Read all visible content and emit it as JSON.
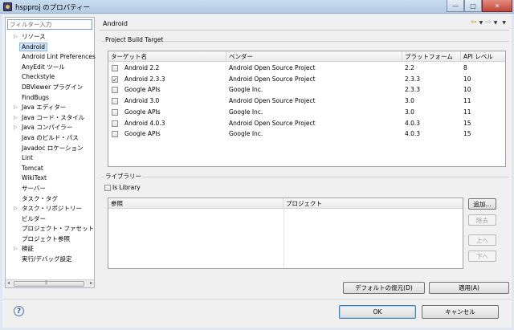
{
  "window": {
    "title": "hspproj のプロパティー",
    "controls": {
      "minimize": "—",
      "maximize": "□",
      "close": "✕"
    }
  },
  "sidebar": {
    "filter_placeholder": "フィルター入力",
    "items": [
      {
        "label": "リソース",
        "expandable": true
      },
      {
        "label": "Android",
        "selected": true
      },
      {
        "label": "Android Lint Preferences"
      },
      {
        "label": "AnyEdit ツール"
      },
      {
        "label": "Checkstyle"
      },
      {
        "label": "DBViewer プラグイン"
      },
      {
        "label": "FindBugs"
      },
      {
        "label": "Java エディター",
        "expandable": true
      },
      {
        "label": "Java コード・スタイル",
        "expandable": true
      },
      {
        "label": "Java コンパイラー",
        "expandable": true
      },
      {
        "label": "Java のビルド・パス"
      },
      {
        "label": "Javadoc ロケーション"
      },
      {
        "label": "Lint"
      },
      {
        "label": "Tomcat"
      },
      {
        "label": "WikiText"
      },
      {
        "label": "サーバー"
      },
      {
        "label": "タスク・タグ"
      },
      {
        "label": "タスク・リポジトリー",
        "expandable": true
      },
      {
        "label": "ビルダー"
      },
      {
        "label": "プロジェクト・ファセット"
      },
      {
        "label": "プロジェクト参照"
      },
      {
        "label": "検証",
        "expandable": true
      },
      {
        "label": "実行/デバッグ設定"
      }
    ]
  },
  "page": {
    "title": "Android"
  },
  "build_target": {
    "group_label": "Project Build Target",
    "columns": [
      "ターゲット名",
      "ベンダー",
      "プラットフォーム",
      "API レベル"
    ],
    "rows": [
      {
        "name": "Android 2.2",
        "vendor": "Android Open Source Project",
        "platform": "2.2",
        "api": "8",
        "checked": false
      },
      {
        "name": "Android 2.3.3",
        "vendor": "Android Open Source Project",
        "platform": "2.3.3",
        "api": "10",
        "checked": true
      },
      {
        "name": "Google APIs",
        "vendor": "Google Inc.",
        "platform": "2.3.3",
        "api": "10",
        "checked": false
      },
      {
        "name": "Android 3.0",
        "vendor": "Android Open Source Project",
        "platform": "3.0",
        "api": "11",
        "checked": false
      },
      {
        "name": "Google APIs",
        "vendor": "Google Inc.",
        "platform": "3.0",
        "api": "11",
        "checked": false
      },
      {
        "name": "Android 4.0.3",
        "vendor": "Android Open Source Project",
        "platform": "4.0.3",
        "api": "15",
        "checked": false
      },
      {
        "name": "Google APIs",
        "vendor": "Google Inc.",
        "platform": "4.0.3",
        "api": "15",
        "checked": false
      }
    ]
  },
  "library": {
    "group_label": "ライブラリー",
    "is_library_label": "Is Library",
    "is_library_checked": false,
    "columns": [
      "参照",
      "プロジェクト"
    ],
    "buttons": {
      "add": "追加...",
      "remove": "除去",
      "up": "上へ",
      "down": "下へ"
    }
  },
  "buttons": {
    "restore_defaults": "デフォルトの復元(D)",
    "apply": "適用(A)",
    "ok": "OK",
    "cancel": "キャンセル"
  }
}
